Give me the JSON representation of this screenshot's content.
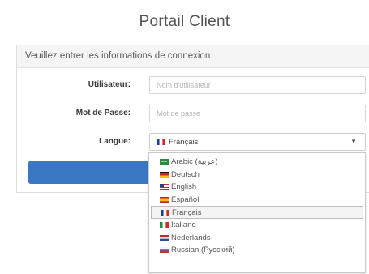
{
  "page": {
    "title": "Portail Client"
  },
  "panel": {
    "heading": "Veuillez entrer les informations de connexion"
  },
  "form": {
    "username_label": "Utilisateur:",
    "username_placeholder": "Nom d'utilisateur",
    "password_label": "Mot de Passe:",
    "password_placeholder": "Mot de passe",
    "language_label": "Langue:",
    "language_selected": "Français"
  },
  "dropdown": {
    "options": [
      {
        "label": "Arabic (عربية)",
        "flag": "saudi-arabia-flag"
      },
      {
        "label": "Deutsch",
        "flag": "germany-flag"
      },
      {
        "label": "English",
        "flag": "usa-flag"
      },
      {
        "label": "Español",
        "flag": "spain-flag"
      },
      {
        "label": "Français",
        "flag": "france-flag",
        "selected": true
      },
      {
        "label": "Italiano",
        "flag": "italy-flag"
      },
      {
        "label": "Nederlands",
        "flag": "netherlands-flag"
      },
      {
        "label": "Russian (Русский)",
        "flag": "russia-flag"
      }
    ]
  },
  "colors": {
    "button": "#3a78c3",
    "panel_heading_bg": "#f5f5f5",
    "selected_option_bg": "#f4f4f4"
  }
}
